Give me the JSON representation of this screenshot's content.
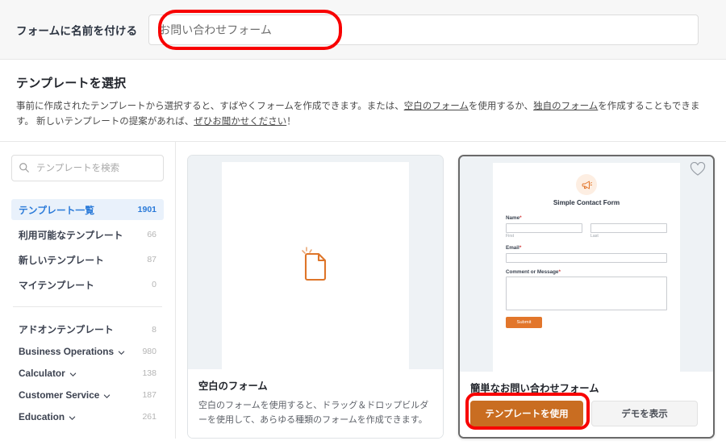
{
  "header": {
    "label": "フォームに名前を付ける",
    "input_placeholder": "お問い合わせフォーム",
    "input_value": ""
  },
  "section": {
    "title": "テンプレートを選択",
    "desc_part1": "事前に作成されたテンプレートから選択すると、すばやくフォームを作成できます。または、",
    "link_blank": "空白のフォーム",
    "desc_part2": "を使用するか、",
    "link_custom": "独自のフォーム",
    "desc_part3": "を作成することもできます。 新しいテンプレートの提案があれば、",
    "link_feedback": "ぜひお聞かせください",
    "desc_part4": "！"
  },
  "sidebar": {
    "search_placeholder": "テンプレートを検索",
    "search_value": "",
    "search_icon": "search-icon",
    "nav": [
      {
        "label": "テンプレート一覧",
        "count": "1901",
        "active": true
      },
      {
        "label": "利用可能なテンプレート",
        "count": "66",
        "active": false
      },
      {
        "label": "新しいテンプレート",
        "count": "87",
        "active": false
      },
      {
        "label": "マイテンプレート",
        "count": "0",
        "active": false
      }
    ],
    "categories": [
      {
        "label": "アドオンテンプレート",
        "count": "8",
        "chevron": false
      },
      {
        "label": "Business Operations",
        "count": "980",
        "chevron": true
      },
      {
        "label": "Calculator",
        "count": "138",
        "chevron": true
      },
      {
        "label": "Customer Service",
        "count": "187",
        "chevron": true
      },
      {
        "label": "Education",
        "count": "261",
        "chevron": true
      }
    ]
  },
  "cards": [
    {
      "id": "blank-form",
      "title": "空白のフォーム",
      "desc": "空白のフォームを使用すると、ドラッグ＆ドロップビルダーを使用して、あらゆる種類のフォームを作成できます。",
      "preview_icon": "document-page-icon",
      "selected": false
    },
    {
      "id": "simple-contact-form",
      "title": "簡単なお問い合わせフォーム",
      "selected": true,
      "favorite_icon": "heart-outline-icon",
      "use_button": "テンプレートを使用",
      "demo_button": "デモを表示",
      "preview": {
        "badge_icon": "megaphone-icon",
        "form_title": "Simple Contact Form",
        "fields": [
          {
            "label": "Name",
            "required": "*",
            "sub_left": "First",
            "sub_right": "Last",
            "type": "name"
          },
          {
            "label": "Email",
            "required": "*",
            "type": "text"
          },
          {
            "label": "Comment or Message",
            "required": "*",
            "type": "textarea"
          }
        ],
        "submit_label": "Submit"
      }
    }
  ],
  "colors": {
    "accent_orange": "#c96d21",
    "preview_orange": "#e2762b",
    "active_blue": "#2a7ad9",
    "annotation_red": "#f80000"
  }
}
